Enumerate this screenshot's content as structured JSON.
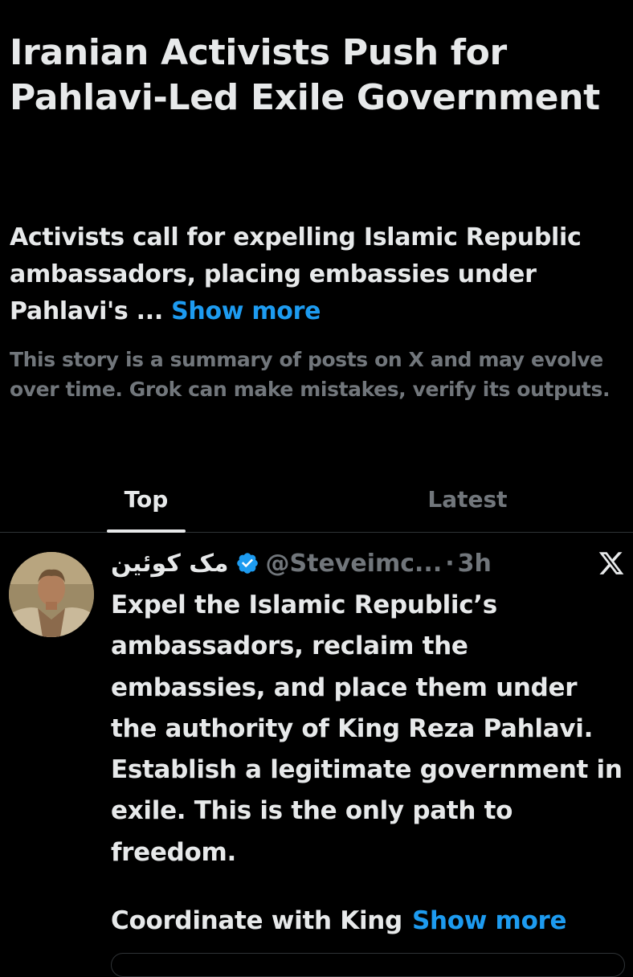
{
  "story": {
    "headline": "Iranian Activists Push for Pahlavi-Led Exile Government",
    "summary": "Activists call for expelling Islamic Republic ambassadors, placing embassies under Pahlavi's ...",
    "show_more": "Show more",
    "disclaimer": "This story is a summary of posts on X and may evolve over time. Grok can make mistakes, verify its outputs."
  },
  "tabs": [
    {
      "label": "Top",
      "active": true
    },
    {
      "label": "Latest",
      "active": false
    }
  ],
  "post": {
    "author_name": "مک کوئین",
    "verified": true,
    "handle": "@Steveimc...",
    "separator": "·",
    "time": "3h",
    "source_icon": "x-logo-icon",
    "text": "Expel the Islamic Republic’s ambassadors, reclaim the embassies, and place them under the authority of King Reza Pahlavi. Establish a legitimate government in exile. This is the only path to freedom.",
    "text_more": "Coordinate with King",
    "show_more": "Show more"
  },
  "colors": {
    "background": "#000000",
    "primary_text": "#e7e9ea",
    "secondary_text": "#71767b",
    "accent": "#1d9bf0",
    "border": "#2f3336"
  }
}
